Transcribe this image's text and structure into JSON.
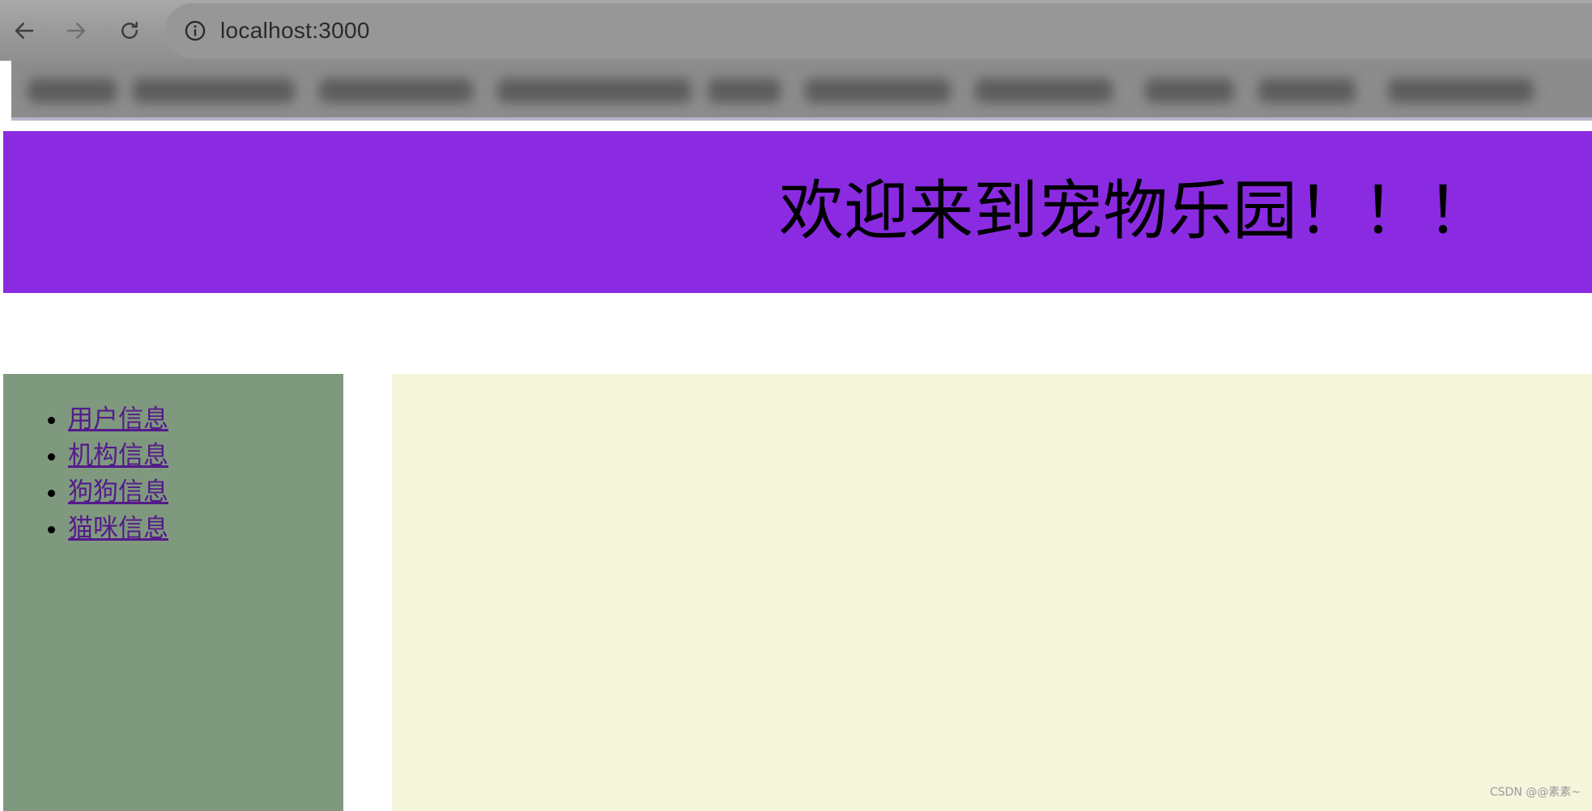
{
  "browser": {
    "address": "localhost:3000",
    "icons": {
      "back": "arrow-left-icon",
      "forward": "arrow-right-icon",
      "reload": "reload-icon",
      "site_info": "info-icon"
    }
  },
  "header": {
    "title": "欢迎来到宠物乐园！！！",
    "background_color": "#8a2be2"
  },
  "sidebar": {
    "background_color": "#7f997e",
    "items": [
      {
        "label": "用户信息"
      },
      {
        "label": "机构信息"
      },
      {
        "label": "狗狗信息"
      },
      {
        "label": "猫咪信息"
      }
    ]
  },
  "content": {
    "background_color": "#f5f5dc"
  },
  "watermark": "CSDN @@素素~"
}
